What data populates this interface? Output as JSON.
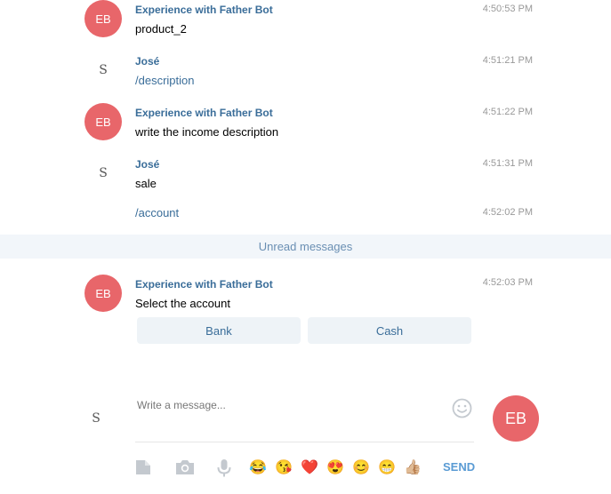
{
  "messages": [
    {
      "avatar": "EB",
      "author": "Experience with Father Bot",
      "time": "4:50:53 PM",
      "text": "product_2"
    },
    {
      "avatar": "S",
      "author": "José",
      "time": "4:51:21 PM",
      "text": "/description"
    },
    {
      "avatar": "EB",
      "author": "Experience with Father Bot",
      "time": "4:51:22 PM",
      "text": "write the income description"
    },
    {
      "avatar": "S",
      "author": "José",
      "time": "4:51:31 PM",
      "text": "sale"
    },
    {
      "time": "4:52:02 PM",
      "text": "/account"
    },
    {
      "avatar": "EB",
      "author": "Experience with Father Bot",
      "time": "4:52:03 PM",
      "text": "Select the account"
    }
  ],
  "unread_label": "Unread messages",
  "keyboard": [
    "Bank",
    "Cash"
  ],
  "composer": {
    "placeholder": "Write a message...",
    "user_avatar": "S",
    "bot_avatar": "EB",
    "send_label": "SEND"
  },
  "emojis": [
    "😂",
    "😘",
    "❤️",
    "😍",
    "😊",
    "😁",
    "👍🏼"
  ],
  "colors": {
    "author": "#3a6d99",
    "avatar_bg": "#e8666a",
    "send": "#5a9bd4",
    "unread_bg": "#f2f6fa"
  }
}
